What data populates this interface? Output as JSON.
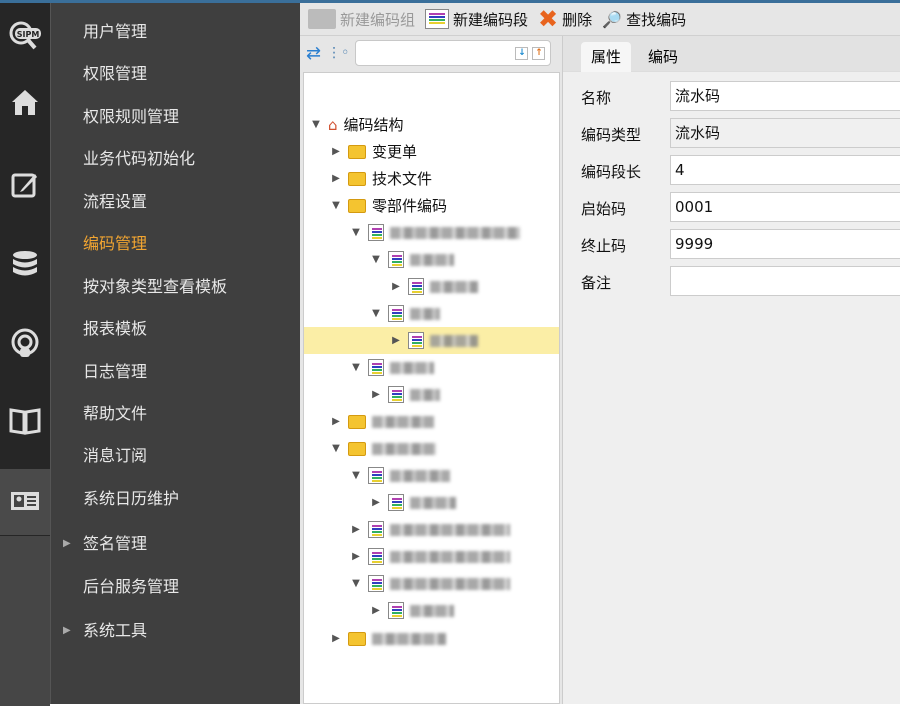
{
  "rail": {
    "icons": [
      "sipm-search-icon",
      "home-icon",
      "edit-icon",
      "database-icon",
      "podcast-user-icon",
      "book-icon",
      "id-card-icon"
    ],
    "logo_text": "SIPM"
  },
  "menu": {
    "items": [
      {
        "label": "用户管理"
      },
      {
        "label": "权限管理"
      },
      {
        "label": "权限规则管理"
      },
      {
        "label": "业务代码初始化"
      },
      {
        "label": "流程设置"
      },
      {
        "label": "编码管理",
        "active": true
      },
      {
        "label": "按对象类型查看模板"
      },
      {
        "label": "报表模板"
      },
      {
        "label": "日志管理"
      },
      {
        "label": "帮助文件"
      },
      {
        "label": "消息订阅"
      },
      {
        "label": "系统日历维护"
      },
      {
        "label": "签名管理",
        "expandable": true
      },
      {
        "label": "后台服务管理"
      },
      {
        "label": "系统工具",
        "expandable": true
      }
    ]
  },
  "toolbar": {
    "new_group": "新建编码组",
    "new_segment": "新建编码段",
    "delete": "删除",
    "find": "查找编码"
  },
  "search": {
    "value": "",
    "placeholder": ""
  },
  "tree": {
    "root": "编码结构",
    "folders": [
      "变更单",
      "技术文件",
      "零部件编码"
    ]
  },
  "tabs": [
    "属性",
    "编码"
  ],
  "form": [
    {
      "label": "名称",
      "value": "流水码"
    },
    {
      "label": "编码类型",
      "value": "流水码",
      "readonly": true
    },
    {
      "label": "编码段长",
      "value": "4"
    },
    {
      "label": "启始码",
      "value": "0001"
    },
    {
      "label": "终止码",
      "value": "9999"
    },
    {
      "label": "备注",
      "value": ""
    }
  ],
  "colors": {
    "active_menu": "#f2a531",
    "selected_row": "#fbeea6"
  }
}
